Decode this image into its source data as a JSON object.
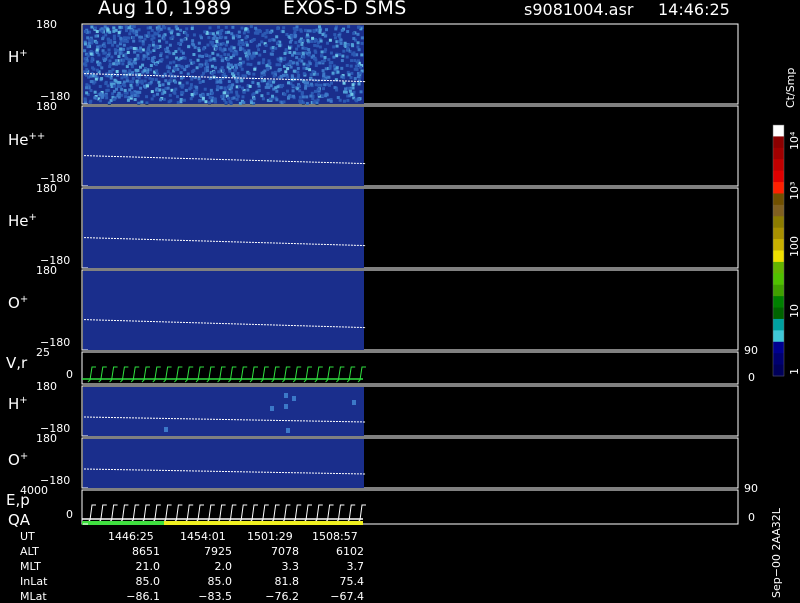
{
  "header": {
    "date": "Aug 10, 1989",
    "instrument": "EXOS-D SMS",
    "file": "s9081004.asr",
    "time": "14:46:25"
  },
  "panels": [
    {
      "id": "h",
      "label_base": "H",
      "label_sup": "+",
      "ytop": "180",
      "ybot": "−180"
    },
    {
      "id": "hepp",
      "label_base": "He",
      "label_sup": "++",
      "ytop": "180",
      "ybot": "−180"
    },
    {
      "id": "hep",
      "label_base": "He",
      "label_sup": "+",
      "ytop": "180",
      "ybot": "−180"
    },
    {
      "id": "op",
      "label_base": "O",
      "label_sup": "+",
      "ytop": "180",
      "ybot": "−180"
    },
    {
      "id": "vr",
      "label_base": "V,r",
      "label_sup": "",
      "ytop": "25",
      "ybot": "0",
      "rtop": "90",
      "rbot": "0"
    },
    {
      "id": "h2",
      "label_base": "H",
      "label_sup": "+",
      "ytop": "180",
      "ybot": "−180"
    },
    {
      "id": "o2",
      "label_base": "O",
      "label_sup": "+",
      "ytop": "180",
      "ybot": "−180"
    },
    {
      "id": "ep",
      "label_base": "E,p",
      "label_sup": "",
      "label2": "QA",
      "ytop": "4000",
      "ybot": "0",
      "rtop": "90",
      "rbot": "0"
    }
  ],
  "colorbar": {
    "title": "Ct/Smp",
    "ticks": [
      "10⁴",
      "10³",
      "100",
      "10",
      "1"
    ],
    "colors": [
      "#ffffff",
      "#8b0000",
      "#a00000",
      "#c00000",
      "#e00000",
      "#ff2000",
      "#705000",
      "#806020",
      "#8c7c00",
      "#a89000",
      "#c8b000",
      "#f0e000",
      "#64b400",
      "#50c000",
      "#40a000",
      "#008000",
      "#006400",
      "#00a0a0",
      "#40c8d8",
      "#000090",
      "#000070",
      "#00005a"
    ]
  },
  "footer": {
    "labels": [
      "UT",
      "ALT",
      "MLT",
      "InLat",
      "MLat"
    ],
    "columns": [
      [
        "1446:25",
        "8651",
        "21.0",
        "85.0",
        "−86.1"
      ],
      [
        "1454:01",
        "7925",
        "2.0",
        "85.0",
        "−83.5"
      ],
      [
        "1501:29",
        "7078",
        "3.3",
        "81.8",
        "−76.2"
      ],
      [
        "1508:57",
        "6102",
        "3.7",
        "75.4",
        "−67.4"
      ]
    ],
    "side_text": "Sep−00  2AA32L"
  },
  "chart_data": {
    "type": "heatmap",
    "title": "Aug 10, 1989 EXOS-D SMS",
    "x_tick_labels": [
      "1446:25",
      "1454:01",
      "1501:29",
      "1508:57"
    ],
    "data_coverage_fraction": 0.39,
    "series": [
      {
        "name": "H+",
        "ylim": [
          -180,
          180
        ]
      },
      {
        "name": "He++",
        "ylim": [
          -180,
          180
        ]
      },
      {
        "name": "He+",
        "ylim": [
          -180,
          180
        ]
      },
      {
        "name": "O+",
        "ylim": [
          -180,
          180
        ]
      },
      {
        "name": "V,r",
        "ylim": [
          0,
          25
        ],
        "right_ylim": [
          0,
          90
        ]
      },
      {
        "name": "H+",
        "ylim": [
          -180,
          180
        ]
      },
      {
        "name": "O+",
        "ylim": [
          -180,
          180
        ]
      },
      {
        "name": "E,p",
        "ylim": [
          0,
          4000
        ],
        "right_ylim": [
          0,
          90
        ]
      }
    ],
    "colorbar_scale": "log",
    "colorbar_range": [
      1,
      10000
    ]
  }
}
